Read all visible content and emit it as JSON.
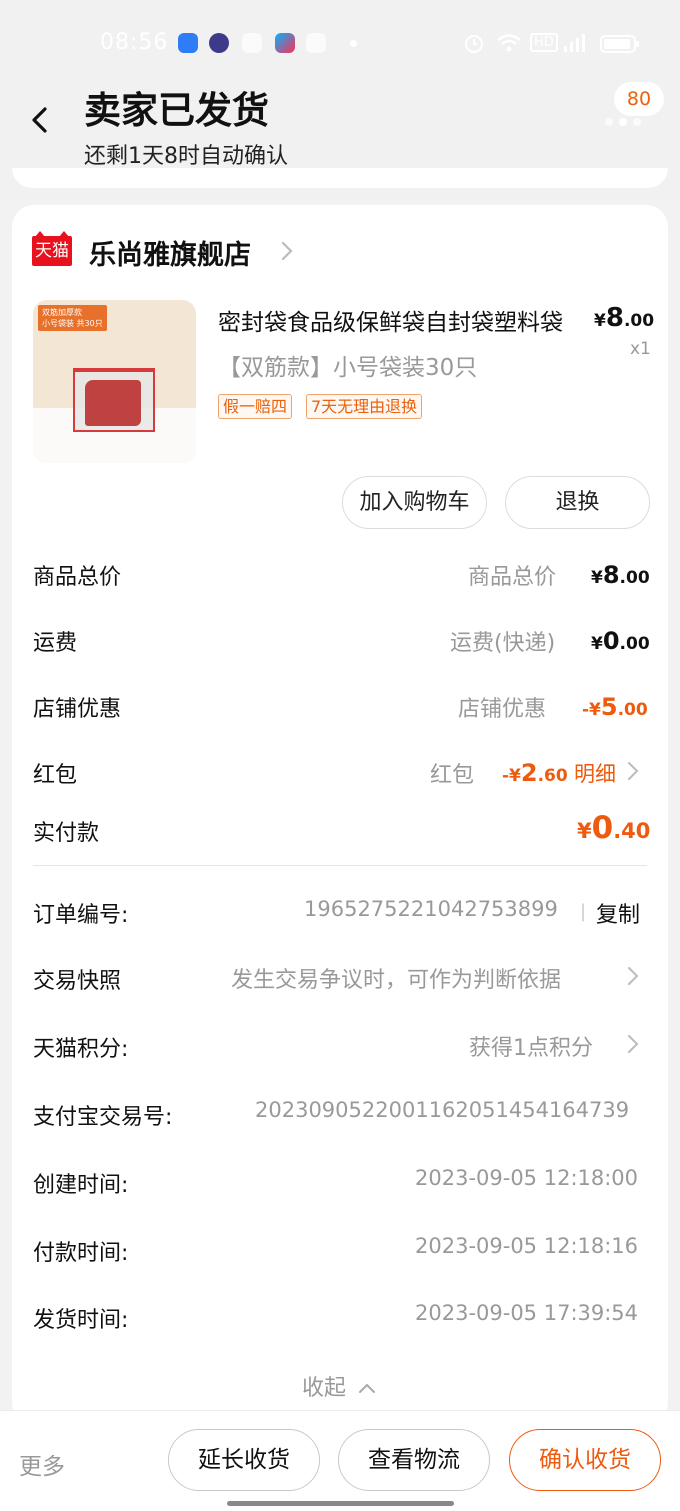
{
  "status_bar": {
    "time": "08:56",
    "network": "HD",
    "battery_level": 0.85
  },
  "header": {
    "title": "卖家已发货",
    "subtitle": "还剩1天8时自动确认",
    "badge_count": "80"
  },
  "shop": {
    "badge": "天猫",
    "name": "乐尚雅旗舰店"
  },
  "product": {
    "image_label_1": "双筋加厚款",
    "image_label_2": "小号袋装 共30只",
    "title": "密封袋食品级保鲜袋自封袋塑料袋",
    "price_symbol": "¥",
    "price_int": "8",
    "price_dec": ".00",
    "quantity": "x1",
    "spec": "【双筋款】小号袋装30只",
    "tags": [
      "假一赔四",
      "7天无理由退换"
    ],
    "actions": {
      "add_to_cart": "加入购物车",
      "return": "退换"
    }
  },
  "summary": {
    "goods_total": {
      "label": "商品总价",
      "hint": "商品总价",
      "symbol": "¥",
      "int": "8",
      "dec": ".00"
    },
    "shipping": {
      "label": "运费",
      "hint": "运费(快递)",
      "symbol": "¥",
      "int": "0",
      "dec": ".00"
    },
    "shop_discount": {
      "label": "店铺优惠",
      "hint": "店铺优惠",
      "symbol": "-¥",
      "int": "5",
      "dec": ".00"
    },
    "red_packet": {
      "label": "红包",
      "hint": "红包",
      "symbol": "-¥",
      "int": "2",
      "dec": ".60",
      "detail": "明细"
    },
    "paid": {
      "label": "实付款",
      "symbol": "¥",
      "int": "0",
      "dec": ".40"
    }
  },
  "order_info": {
    "order_no": {
      "label": "订单编号:",
      "value": "1965275221042753899",
      "sep": "|",
      "copy": "复制"
    },
    "snapshot": {
      "label": "交易快照",
      "value": "发生交易争议时，可作为判断依据"
    },
    "points": {
      "label": "天猫积分:",
      "value": "获得1点积分"
    },
    "alipay_no": {
      "label": "支付宝交易号:",
      "value": "2023090522001162051454164739"
    },
    "created": {
      "label": "创建时间:",
      "value": "2023-09-05 12:18:00"
    },
    "paid_time": {
      "label": "付款时间:",
      "value": "2023-09-05 12:18:16"
    },
    "shipped": {
      "label": "发货时间:",
      "value": "2023-09-05 17:39:54"
    },
    "collapse": "收起"
  },
  "bottom_bar": {
    "more": "更多",
    "extend": "延长收货",
    "logistics": "查看物流",
    "confirm": "确认收货"
  },
  "colors": {
    "accent": "#ee5a0e",
    "tmall_red": "#e8121e",
    "background": "#f2f2f2"
  }
}
